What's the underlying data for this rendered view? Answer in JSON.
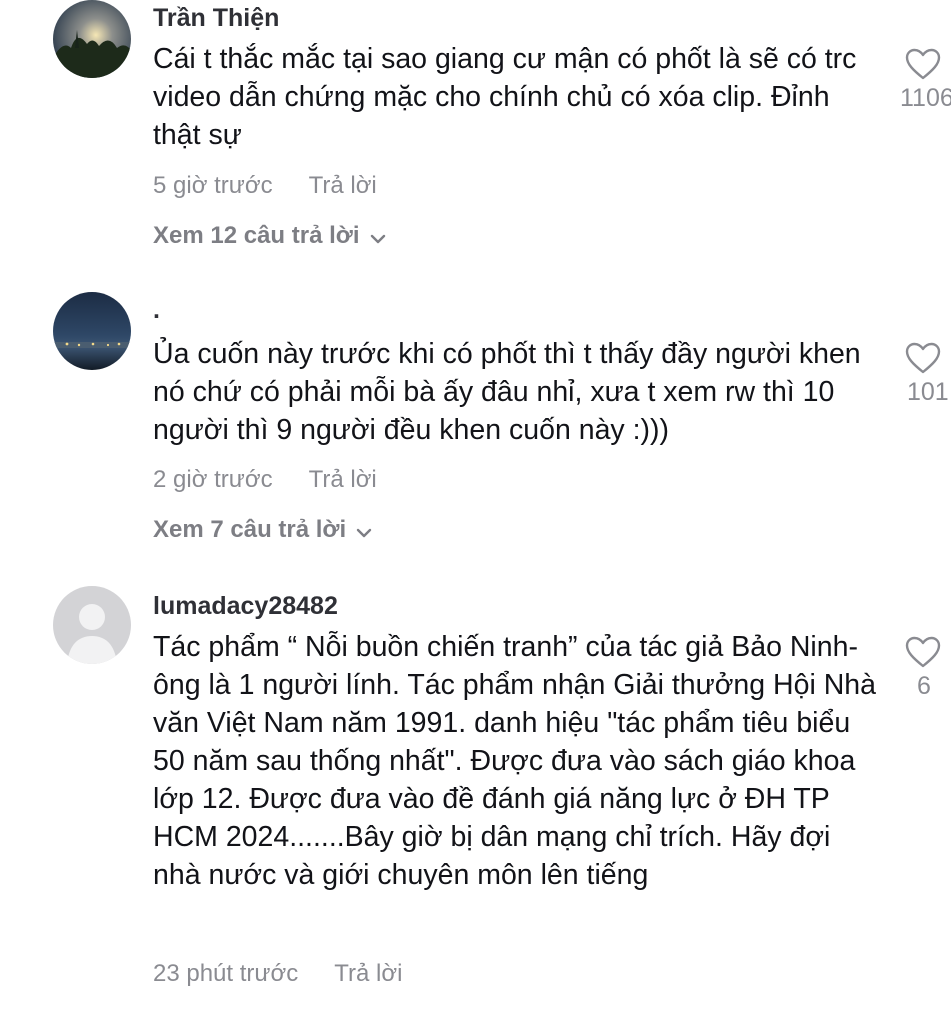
{
  "comments": [
    {
      "username": "Trần Thiện",
      "text": "Cái t thắc mắc tại sao giang cư mận có phốt là sẽ có trc video dẫn chứng mặc cho chính chủ có xóa clip. Đỉnh thật sự",
      "time": "5 giờ trước",
      "reply_label": "Trả lời",
      "view_replies": "Xem 12 câu trả lời",
      "likes": "1106"
    },
    {
      "username": ".",
      "text": "Ủa cuốn này trước khi có phốt thì t thấy đầy người khen nó chứ có phải mỗi bà ấy đâu nhỉ, xưa t xem rw thì 10 người thì 9 người đều khen cuốn này :)))",
      "time": "2 giờ trước",
      "reply_label": "Trả lời",
      "view_replies": "Xem 7 câu trả lời",
      "likes": "101"
    },
    {
      "username": "lumadacy28482",
      "text": "Tác phẩm “ Nỗi buồn chiến tranh” của tác giả Bảo Ninh- ông là 1 người lính. Tác phẩm nhận Giải thưởng Hội Nhà văn Việt Nam năm 1991. danh hiệu \"tác phẩm tiêu biểu 50 năm sau thống nhất\". Được đưa vào sách giáo khoa lớp 12. Được đưa vào đề đánh giá năng lực ở ĐH TP HCM 2024.......Bây giờ bị dân mạng chỉ trích. Hãy đợi nhà nước và giới chuyên môn lên tiếng",
      "time": "23 phút trước",
      "reply_label": "Trả lời",
      "likes": "6"
    }
  ],
  "colors": {
    "text": "#121318",
    "username": "#2f3036",
    "meta": "#8a8b91",
    "icon": "#8a8b91"
  }
}
